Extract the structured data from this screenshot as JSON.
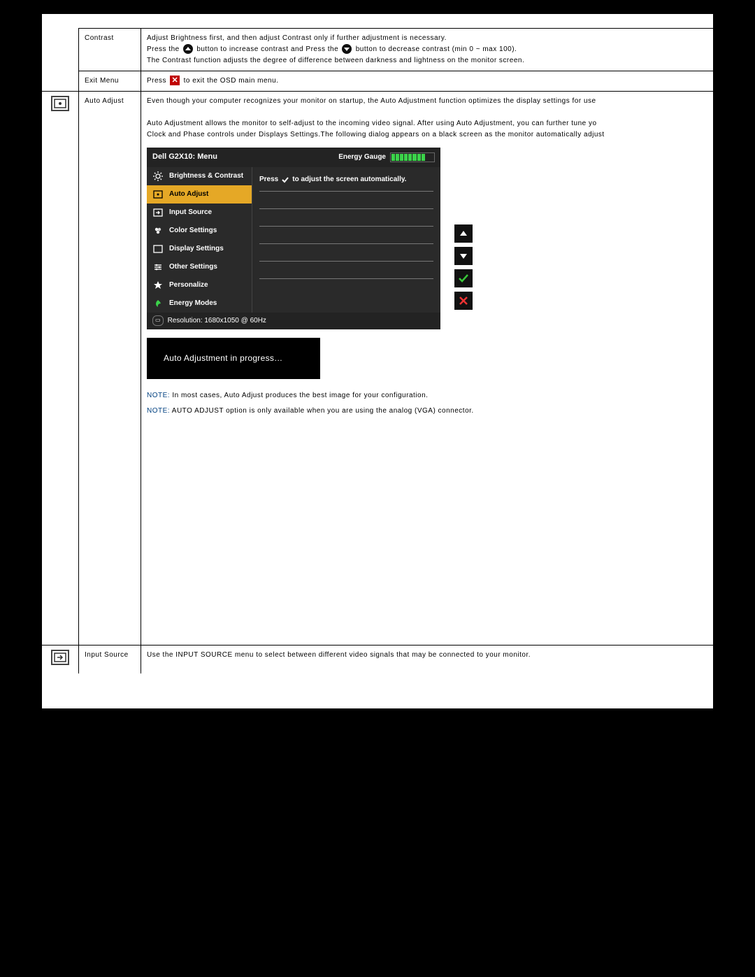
{
  "rows": {
    "contrast": {
      "label": "Contrast",
      "line1": "Adjust Brightness first, and then adjust Contrast only if further adjustment is necessary.",
      "line2a": "Press the ",
      "line2b": " button to increase contrast and Press the ",
      "line2c": " button to decrease contrast (min 0 ~ max 100).",
      "line3": "The Contrast function adjusts the degree of difference between darkness and lightness on the monitor screen."
    },
    "exit": {
      "label": "Exit Menu",
      "text_a": "Press ",
      "text_b": " to exit the OSD main menu."
    },
    "auto": {
      "label": "Auto Adjust",
      "p1": "Even though your computer recognizes your monitor on startup, the Auto Adjustment function optimizes the display settings for use",
      "p2": "Auto Adjustment allows the monitor to self-adjust to the incoming video signal. After using Auto Adjustment, you can further tune yo",
      "p3": "Clock and Phase controls under Displays Settings.The following dialog appears on a black screen as the monitor automatically adjust",
      "progress": "Auto Adjustment in progress…",
      "note1_label": "NOTE:",
      "note1_text": " In most cases, Auto Adjust produces the best image for your configuration.",
      "note2_label": "NOTE:",
      "note2_text": " AUTO ADJUST option is only available when you are using the analog (VGA) connector."
    },
    "input": {
      "label": "Input Source",
      "text": "Use the INPUT SOURCE menu to select between different video signals that may be connected to your monitor."
    }
  },
  "osd": {
    "title": "Dell G2X10: Menu",
    "energy_label": "Energy Gauge",
    "items": [
      "Brightness & Contrast",
      "Auto Adjust",
      "Input Source",
      "Color Settings",
      "Display Settings",
      "Other Settings",
      "Personalize",
      "Energy Modes"
    ],
    "right_msg_a": "Press",
    "right_msg_b": "to adjust the screen automatically.",
    "footer_res": "Resolution: 1680x1050 @ 60Hz"
  }
}
